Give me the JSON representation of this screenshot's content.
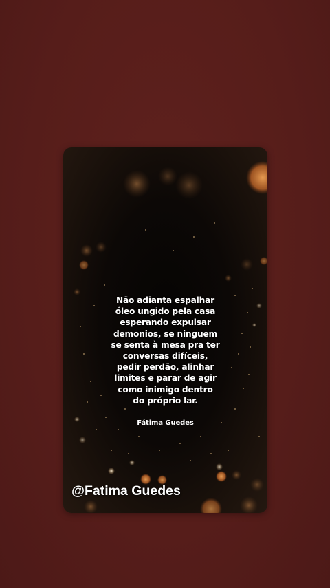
{
  "quote": {
    "lines": [
      "Não adianta espalhar",
      "óleo ungido pela casa",
      "esperando expulsar",
      "demonios, se ninguem",
      "se senta à mesa pra ter",
      "conversas difíceis,",
      "pedir perdão, alinhar",
      "limites e parar de agir",
      "como inimigo dentro",
      "do próprio lar."
    ],
    "author": "Fátima Guedes"
  },
  "watermark": "@Fatima Guedes",
  "colors": {
    "background": "#5a1f1c",
    "card": "#0c0806",
    "bokeh_warm": "#d98a3a",
    "text": "#ffffff"
  }
}
